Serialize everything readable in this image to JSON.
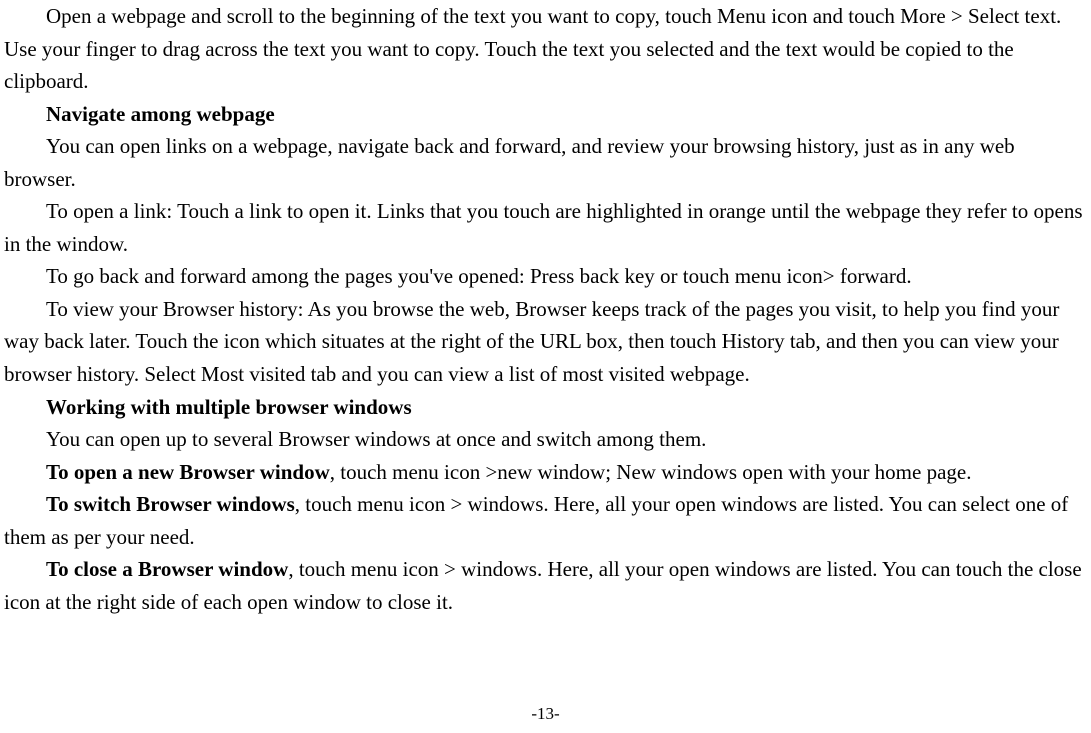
{
  "paragraphs": {
    "p1": "Open a webpage and scroll to the beginning of the text you want to copy, touch Menu icon and touch More > Select text. Use your finger to drag across the text you want to copy. Touch the text you selected and the text would be copied to the clipboard.",
    "h1": "Navigate among webpage",
    "p2": "You can open links on a webpage, navigate back and forward, and review your browsing history, just as in any web browser.",
    "p3": "To open a link: Touch a link to open it. Links that you touch are highlighted in orange until the webpage they refer to opens in the window.",
    "p4": "To go back and forward among the pages you've opened: Press back key or touch menu icon> forward.",
    "p5": "To view your Browser history: As you browse the web, Browser keeps track of the pages you visit, to help you find your way back later. Touch the icon which situates at the right of the URL box, then touch History tab, and then you can view your browser history. Select Most visited tab and you can view a list of most visited webpage.",
    "h2": "Working with multiple browser windows",
    "p6": "You can open up to several Browser windows at once and switch among them.",
    "p7_bold": "To open a new Browser window",
    "p7_rest": ", touch menu icon >new window; New windows open with your home page.",
    "p8_bold": "To switch Browser windows",
    "p8_rest": ", touch menu icon > windows. Here, all your open windows are listed. You can select one of them as per your need.",
    "p9_bold": "To close a Browser window",
    "p9_rest": ", touch menu icon > windows. Here, all your open windows are listed. You can touch the close icon at the right side of each open window to close it."
  },
  "page_number": "-13-"
}
